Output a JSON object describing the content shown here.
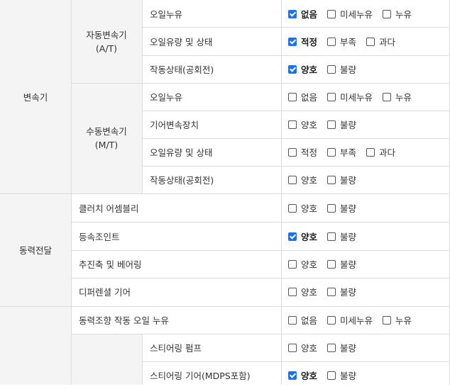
{
  "groups": [
    {
      "name": "변속기"
    },
    {
      "name": "동력전달"
    }
  ],
  "subgroups": [
    {
      "name": "자동변속기\n(A/T)"
    },
    {
      "name": "수동변속기\n(M/T)"
    }
  ],
  "rows": [
    {
      "item": "오일누유",
      "options": [
        {
          "label": "없음",
          "checked": true
        },
        {
          "label": "미세누유",
          "checked": false
        },
        {
          "label": "누유",
          "checked": false
        }
      ]
    },
    {
      "item": "오일유량 및 상태",
      "options": [
        {
          "label": "적정",
          "checked": true
        },
        {
          "label": "부족",
          "checked": false
        },
        {
          "label": "과다",
          "checked": false
        }
      ]
    },
    {
      "item": "작동상태(공회전)",
      "options": [
        {
          "label": "양호",
          "checked": true
        },
        {
          "label": "불량",
          "checked": false
        }
      ]
    },
    {
      "item": "오일누유",
      "options": [
        {
          "label": "없음",
          "checked": false
        },
        {
          "label": "미세누유",
          "checked": false
        },
        {
          "label": "누유",
          "checked": false
        }
      ]
    },
    {
      "item": "기어변속장치",
      "options": [
        {
          "label": "양호",
          "checked": false
        },
        {
          "label": "불량",
          "checked": false
        }
      ]
    },
    {
      "item": "오일유량 및 상태",
      "options": [
        {
          "label": "적정",
          "checked": false
        },
        {
          "label": "부족",
          "checked": false
        },
        {
          "label": "과다",
          "checked": false
        }
      ]
    },
    {
      "item": "작동상태(공회전)",
      "options": [
        {
          "label": "양호",
          "checked": false
        },
        {
          "label": "불량",
          "checked": false
        }
      ]
    },
    {
      "item": "클러치 어셈블리",
      "options": [
        {
          "label": "양호",
          "checked": false
        },
        {
          "label": "불량",
          "checked": false
        }
      ]
    },
    {
      "item": "등속조인트",
      "options": [
        {
          "label": "양호",
          "checked": true
        },
        {
          "label": "불량",
          "checked": false
        }
      ]
    },
    {
      "item": "추진축 및 베어링",
      "options": [
        {
          "label": "양호",
          "checked": false
        },
        {
          "label": "불량",
          "checked": false
        }
      ]
    },
    {
      "item": "디퍼렌셜 기어",
      "options": [
        {
          "label": "양호",
          "checked": false
        },
        {
          "label": "불량",
          "checked": false
        }
      ]
    },
    {
      "item": "동력조향 작동 오일 누유",
      "options": [
        {
          "label": "없음",
          "checked": false
        },
        {
          "label": "미세누유",
          "checked": false
        },
        {
          "label": "누유",
          "checked": false
        }
      ]
    },
    {
      "item": "스티어링 펌프",
      "options": [
        {
          "label": "양호",
          "checked": false
        },
        {
          "label": "불량",
          "checked": false
        }
      ]
    },
    {
      "item": "스티어링 기어(MDPS포함)",
      "options": [
        {
          "label": "양호",
          "checked": true
        },
        {
          "label": "불량",
          "checked": false
        }
      ]
    }
  ],
  "colors": {
    "check": "#1a73e8",
    "border": "#dcdcdc",
    "gray": "#f4f4f4"
  }
}
